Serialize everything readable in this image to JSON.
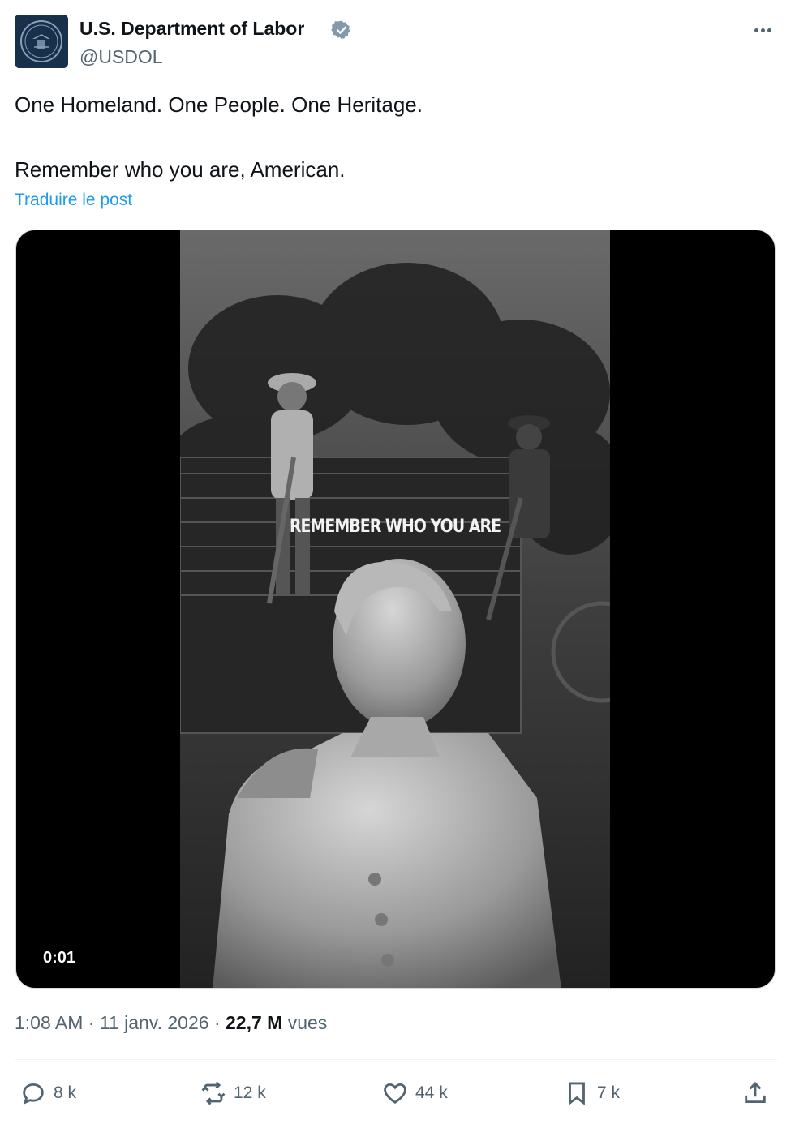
{
  "author": {
    "name": "U.S. Department of Labor",
    "handle": "@USDOL",
    "verified_icon": "verified-badge-icon",
    "avatar_icon": "department-seal-icon"
  },
  "post": {
    "line1": "One Homeland. One People. One Heritage.",
    "line2": "Remember who you are, American.",
    "translate_label": "Traduire le post"
  },
  "media": {
    "overlay_caption": "REMEMBER WHO YOU ARE",
    "timecode": "0:01"
  },
  "meta": {
    "time": "1:08 AM",
    "separator": "·",
    "date": "11 janv. 2026",
    "views_count": "22,7 M",
    "views_label": "vues"
  },
  "actions": {
    "replies": "8 k",
    "reposts": "12 k",
    "likes": "44 k",
    "bookmarks": "7 k"
  },
  "colors": {
    "accent": "#1d9bf0",
    "text": "#0f1419",
    "secondary": "#536471",
    "avatar_bg": "#18304a"
  }
}
